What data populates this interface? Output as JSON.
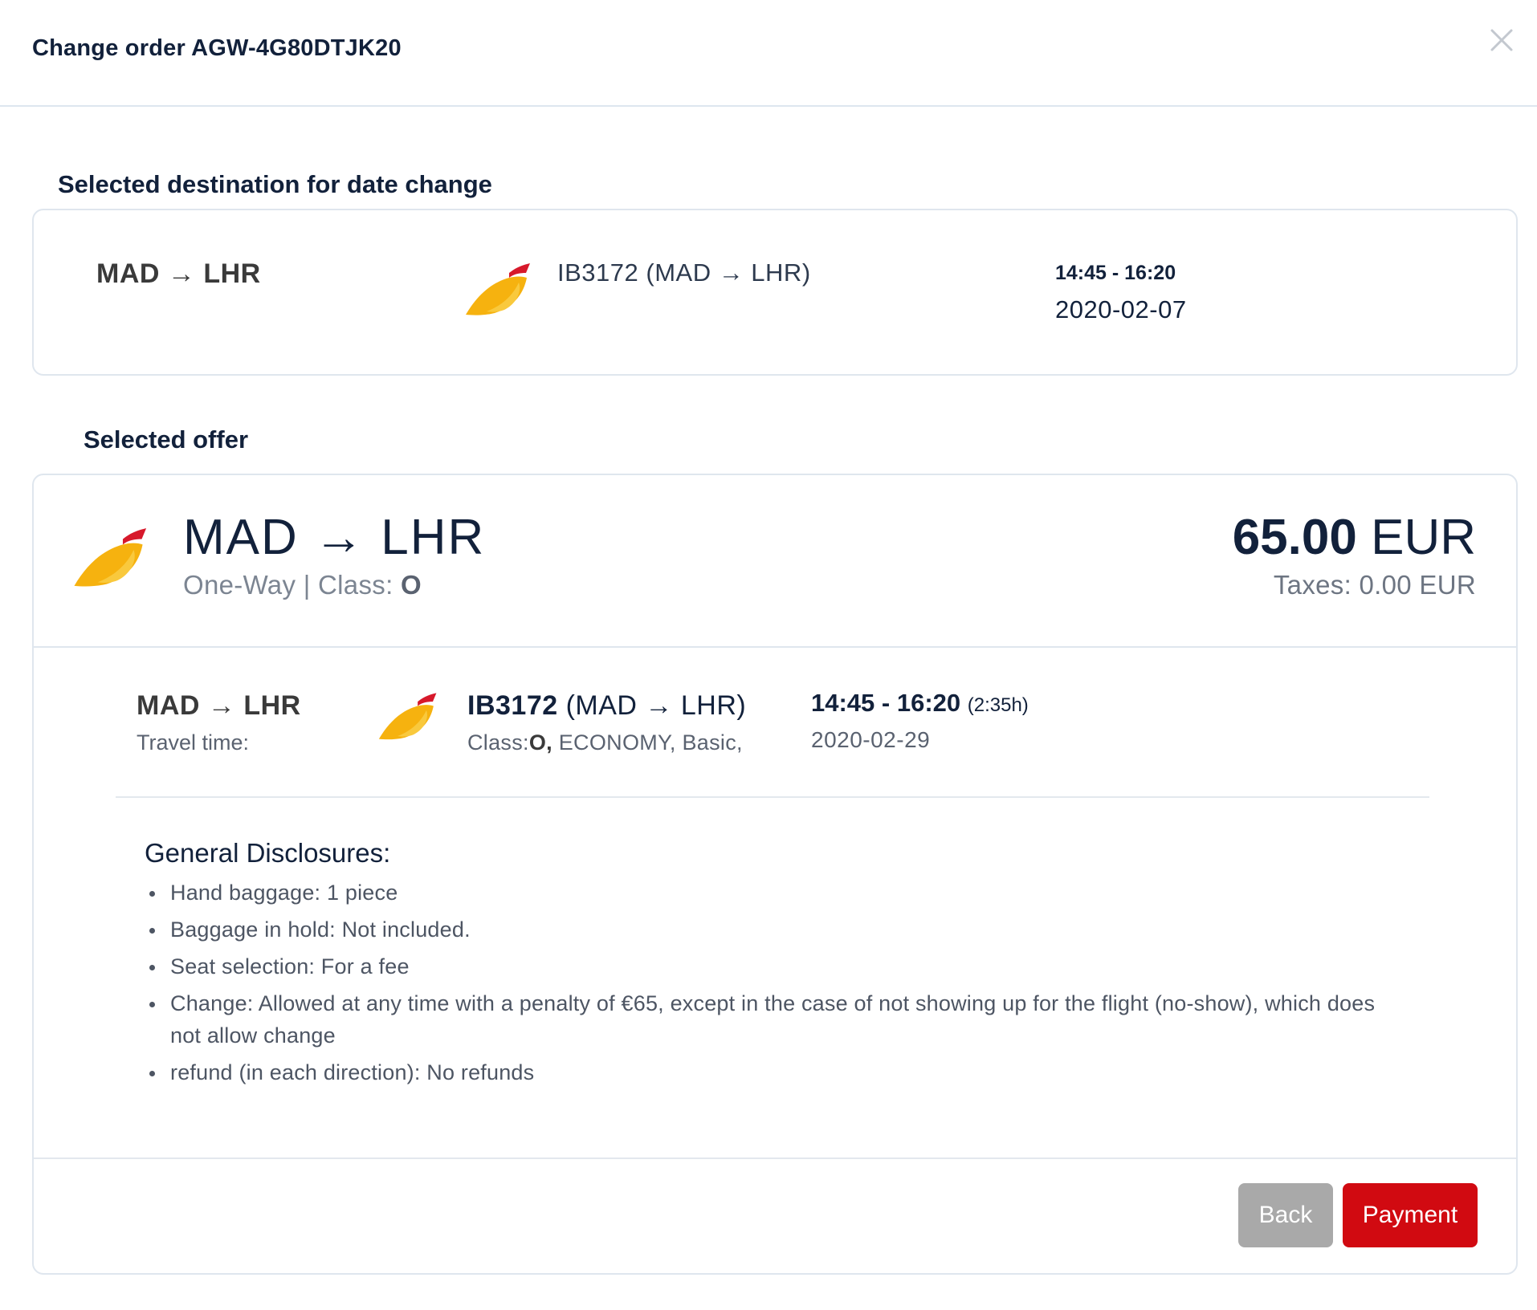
{
  "header": {
    "title": "Change order AGW-4G80DTJK20"
  },
  "colors": {
    "accent_red": "#d10a11",
    "back_gray": "#a9a9a9",
    "logo_red": "#d7192b",
    "logo_yellow": "#f6b20f"
  },
  "destination_section": {
    "title": "Selected destination for date change",
    "route": "MAD → LHR",
    "flight": "IB3172 (MAD → LHR)",
    "times": "14:45 - 16:20",
    "date": "2020-02-07"
  },
  "offer_section": {
    "title": "Selected offer",
    "route": "MAD → LHR",
    "trip_type": "One-Way | Class: ",
    "class_code": "O",
    "price_amount": "65.00",
    "price_currency": " EUR",
    "taxes": "Taxes: 0.00 EUR",
    "segment": {
      "route": "MAD → LHR",
      "travel_time_label": "Travel time:",
      "flight_number": "IB3172",
      "flight_route": " (MAD → LHR)",
      "class_label": "Class:",
      "class_code": "O,",
      "class_rest": " ECONOMY, Basic,",
      "times": "14:45 - 16:20",
      "duration": "(2:35h)",
      "date": "2020-02-29"
    },
    "disclosures": {
      "title": "General Disclosures:",
      "items": [
        "Hand baggage: 1 piece",
        "Baggage in hold: Not included.",
        "Seat selection: For a fee",
        "Change: Allowed at any time with a penalty of €65, except in the case of not showing up for the flight (no-show), which does not allow change",
        "refund (in each direction): No refunds"
      ]
    }
  },
  "actions": {
    "back_label": "Back",
    "payment_label": "Payment"
  }
}
